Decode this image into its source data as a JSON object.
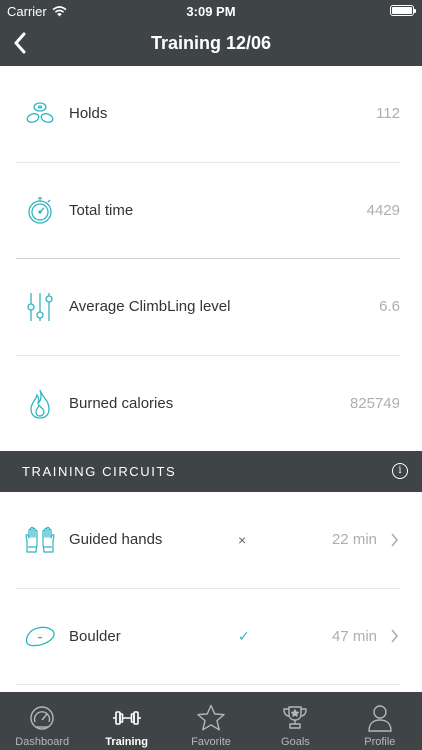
{
  "status_bar": {
    "carrier": "Carrier",
    "time": "3:09 PM"
  },
  "nav": {
    "title": "Training 12/06"
  },
  "stats": [
    {
      "icon": "holds-icon",
      "label": "Holds",
      "value": "112"
    },
    {
      "icon": "stopwatch-icon",
      "label": "Total time",
      "value": "4429"
    },
    {
      "icon": "sliders-icon",
      "label": "Average ClimbLing level",
      "value": "6.6"
    },
    {
      "icon": "flame-icon",
      "label": "Burned calories",
      "value": "825749"
    }
  ],
  "section": {
    "title": "TRAINING CIRCUITS",
    "info_glyph": "i"
  },
  "circuits": [
    {
      "icon": "hands-icon",
      "label": "Guided hands",
      "status": "×",
      "status_icon": "cross-icon",
      "duration": "22 min"
    },
    {
      "icon": "boulder-icon",
      "label": "Boulder",
      "status": "✓",
      "status_icon": "check-icon",
      "duration": "47 min"
    }
  ],
  "tabs": [
    {
      "icon": "speedometer-icon",
      "label": "Dashboard",
      "active": false
    },
    {
      "icon": "dumbbell-icon",
      "label": "Training",
      "active": true
    },
    {
      "icon": "star-icon",
      "label": "Favorite",
      "active": false
    },
    {
      "icon": "trophy-icon",
      "label": "Goals",
      "active": false
    },
    {
      "icon": "person-icon",
      "label": "Profile",
      "active": false
    }
  ],
  "colors": {
    "header": "#3f4446",
    "accent": "#2eb5c2",
    "muted": "#a9b0b3"
  }
}
